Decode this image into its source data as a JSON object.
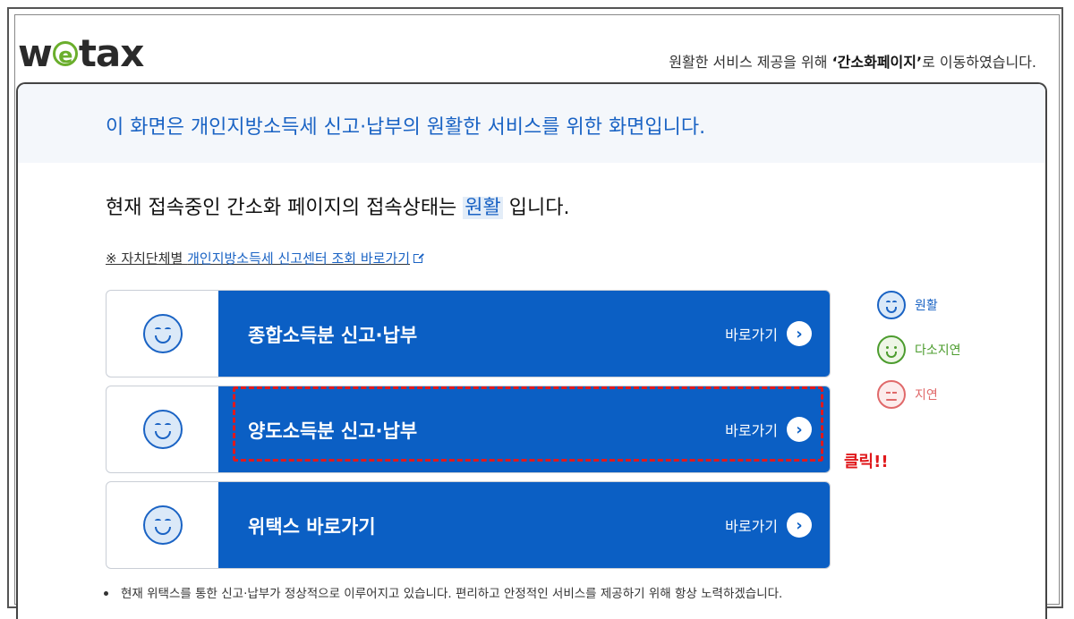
{
  "logo": {
    "prefix": "w",
    "e": "e",
    "suffix": "tax"
  },
  "top_notice": {
    "before": "원활한 서비스 제공을 위해 ",
    "bold": "‘간소화페이지’",
    "after": "로 이동하였습니다."
  },
  "banner": {
    "text": "이 화면은 개인지방소득세 신고·납부의 원활한 서비스를 위한 화면입니다."
  },
  "status": {
    "before": "현재 접속중인 간소화 페이지의 접속상태는 ",
    "status_word": "원활",
    "after": " 입니다."
  },
  "center_link": {
    "prefix": "※ 자치단체별 ",
    "link": "개인지방소득세 신고센터 조회 바로가기"
  },
  "rows": [
    {
      "title": "종합소득분 신고·납부",
      "go_label": "바로가기"
    },
    {
      "title": "양도소득분 신고·납부",
      "go_label": "바로가기"
    },
    {
      "title": "위택스 바로가기",
      "go_label": "바로가기"
    }
  ],
  "legend": [
    {
      "label": "원활",
      "color": "#1a63c4",
      "icon": "smile-face-icon"
    },
    {
      "label": "다소지연",
      "color": "#4c9c2e",
      "icon": "neutral-smile-face-icon"
    },
    {
      "label": "지연",
      "color": "#e0696a",
      "icon": "sad-face-icon"
    }
  ],
  "annotation": {
    "click_label": "클릭!!",
    "color": "#e0191c"
  },
  "footnote": {
    "text": "현재 위택스를 통한 신고·납부가 정상적으로 이루어지고 있습니다. 편리하고 안정적인 서비스를 제공하기 위해 항상 노력하겠습니다."
  },
  "colors": {
    "accent": "#0b5fc4",
    "text_blue": "#1a63c4"
  }
}
